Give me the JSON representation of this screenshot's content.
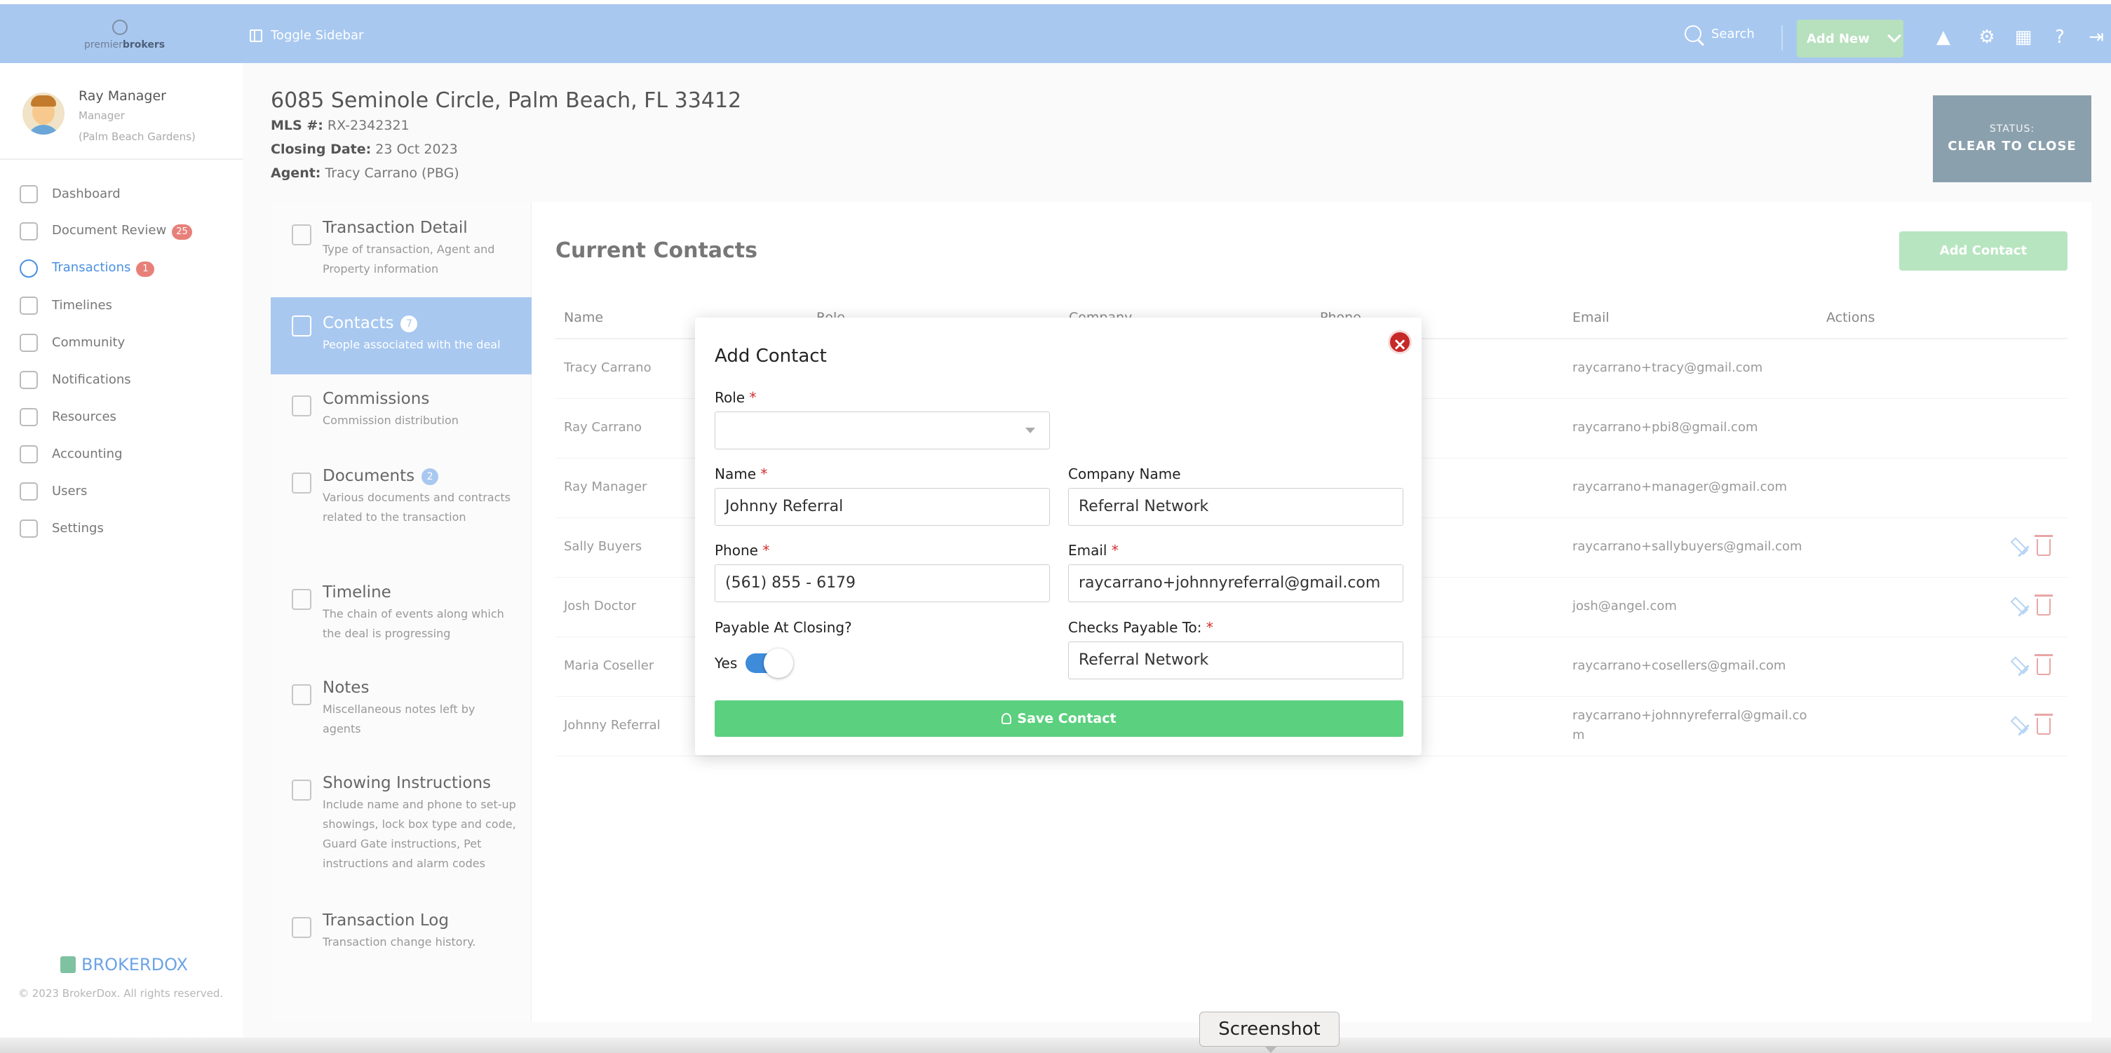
{
  "topbar": {
    "logo_text_a": "premier",
    "logo_text_b": "brokers",
    "toggle_label": "Toggle Sidebar",
    "search_label": "Search",
    "add_new_label": "Add New",
    "bg_color": "#a8c8f0"
  },
  "user": {
    "name": "Ray Manager",
    "role": "Manager",
    "office": "(Palm Beach Gardens)"
  },
  "nav": {
    "items": [
      {
        "label": "Dashboard",
        "icon": "dashboard-icon"
      },
      {
        "label": "Document Review",
        "badge": "25",
        "icon": "document-review-icon"
      },
      {
        "label": "Transactions",
        "badge": "1",
        "icon": "transactions-icon",
        "active": true
      },
      {
        "label": "Timelines",
        "icon": "timelines-icon"
      },
      {
        "label": "Community",
        "icon": "community-icon"
      },
      {
        "label": "Notifications",
        "icon": "notifications-icon"
      },
      {
        "label": "Resources",
        "icon": "resources-icon"
      },
      {
        "label": "Accounting",
        "icon": "accounting-icon"
      },
      {
        "label": "Users",
        "icon": "users-icon"
      },
      {
        "label": "Settings",
        "icon": "settings-icon"
      }
    ]
  },
  "footer": {
    "brand": "BROKERDOX",
    "copyright": "© 2023 BrokerDox. All rights reserved."
  },
  "header": {
    "address": "6085 Seminole Circle, Palm Beach, FL 33412",
    "mls_label": "MLS #:",
    "mls_value": "RX-2342321",
    "closing_label": "Closing Date:",
    "closing_value": "23 Oct 2023",
    "agent_label": "Agent:",
    "agent_value": "Tracy Carrano (PBG)",
    "status_label": "STATUS:",
    "status_value": "CLEAR TO CLOSE"
  },
  "tabs": [
    {
      "title": "Transaction Detail",
      "desc": "Type of transaction, Agent and Property information"
    },
    {
      "title": "Contacts",
      "badge": "7",
      "desc": "People associated with the deal",
      "active": true
    },
    {
      "title": "Commissions",
      "desc": "Commission distribution"
    },
    {
      "title": "Documents",
      "badge": "2",
      "desc": "Various documents and contracts related to the transaction"
    },
    {
      "title": "Timeline",
      "desc": "The chain of events along which the deal is progressing"
    },
    {
      "title": "Notes",
      "desc": "Miscellaneous notes left by agents"
    },
    {
      "title": "Showing Instructions",
      "desc": "Include name and phone to set-up showings, lock box type and code, Guard Gate instructions, Pet instructions and alarm codes"
    },
    {
      "title": "Transaction Log",
      "desc": "Transaction change history."
    }
  ],
  "contacts": {
    "title": "Current Contacts",
    "add_label": "Add Contact",
    "columns": [
      "Name",
      "Role",
      "Company",
      "Phone",
      "Email",
      "Actions"
    ],
    "rows": [
      {
        "name": "Tracy Carrano",
        "email": "raycarrano+tracy@gmail.com",
        "actions": false
      },
      {
        "name": "Ray Carrano",
        "email": "raycarrano+pbi8@gmail.com",
        "actions": false
      },
      {
        "name": "Ray Manager",
        "email": "raycarrano+manager@gmail.com",
        "actions": false
      },
      {
        "name": "Sally Buyers",
        "email": "raycarrano+sallybuyers@gmail.com",
        "actions": true
      },
      {
        "name": "Josh Doctor",
        "email": "josh@angel.com",
        "actions": true
      },
      {
        "name": "Maria Coseller",
        "email": "raycarrano+cosellers@gmail.com",
        "actions": true
      },
      {
        "name": "Johnny Referral",
        "email": "raycarrano+johnnyreferral@gmail.co",
        "email2": "m",
        "actions": true
      }
    ]
  },
  "modal": {
    "title": "Add Contact",
    "close_glyph": "×",
    "role_label": "Role",
    "role_value": "",
    "name_label": "Name",
    "name_value": "Johnny Referral",
    "company_label": "Company Name",
    "company_value": "Referral Network",
    "phone_label": "Phone",
    "phone_value": "(561) 855 - 6179",
    "email_label": "Email",
    "email_value": "raycarrano+johnnyreferral@gmail.com",
    "payable_label": "Payable At Closing?",
    "payable_toggle_label": "Yes",
    "checks_label": "Checks Payable To:",
    "checks_value": "Referral Network",
    "required_mark": "*",
    "save_label": "Save Contact"
  },
  "tooltip": {
    "label": "Screenshot"
  }
}
